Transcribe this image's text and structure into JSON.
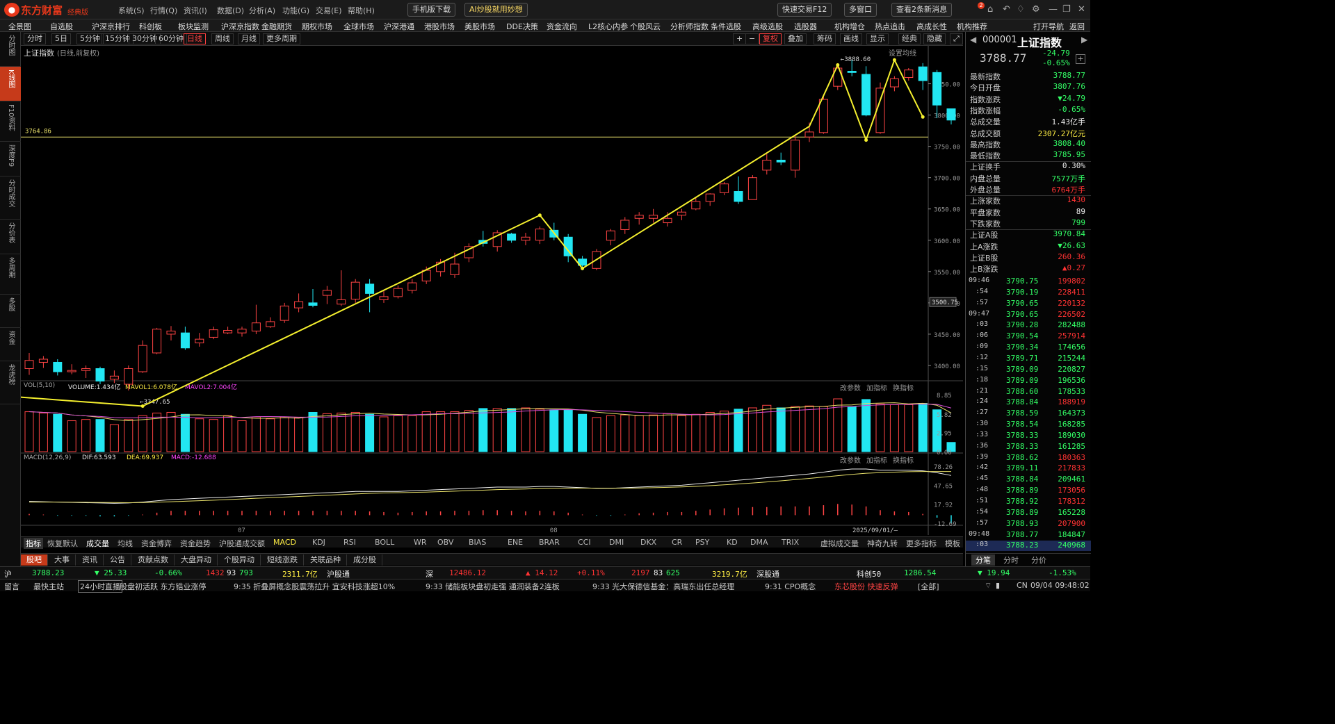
{
  "app": {
    "brand": "东方财富",
    "brand_sub": "经典版",
    "menus": [
      "系统(S)",
      "行情(Q)",
      "资讯(I)",
      "数据(D)",
      "分析(A)",
      "功能(G)",
      "交易(E)",
      "帮助(H)"
    ],
    "mobile_btn": "手机版下载",
    "ai_btn": "AI炒股就用妙想",
    "quick_trade": "快速交易F12",
    "multi_window": "多窗口",
    "message": "查看2条新消息",
    "msg_badge": "2"
  },
  "nav": [
    "全景图",
    "自选股",
    "沪深京排行",
    "科创板",
    "板块监测",
    "沪深京指数",
    "金融期货",
    "期权市场",
    "全球市场",
    "沪深港通",
    "港股市场",
    "美股市场",
    "DDE决策",
    "资金流向",
    "L2核心内参",
    "个股风云",
    "分析师指数",
    "条件选股",
    "高级选股",
    "选股器",
    "机构增仓",
    "热点追击",
    "高成长性",
    "机构推荐",
    "打开导航",
    "返回"
  ],
  "sidebar": [
    "分时图",
    "K线图",
    "F10资料",
    "深度F9",
    "分时成交",
    "分价表",
    "多周期",
    "多股",
    "资金",
    "龙虎榜"
  ],
  "periods": [
    "分时",
    "5日",
    "5分钟",
    "15分钟",
    "30分钟",
    "60分钟",
    "日线",
    "周线",
    "月线",
    "更多周期"
  ],
  "period_selected": "日线",
  "chart_tools": [
    "复权",
    "叠加",
    "筹码",
    "画线",
    "显示",
    "经典",
    "隐藏"
  ],
  "chart_header": {
    "index_name": "上证指数",
    "desc": "(日线,前复权)",
    "set_ma": "设置均线"
  },
  "chart_data": {
    "type": "candlestick",
    "title": "上证指数",
    "ylim": [
      3380,
      3895
    ],
    "y_ticks": [
      3400.0,
      3450.0,
      3500.0,
      3550.0,
      3600.0,
      3650.0,
      3700.0,
      3750.0,
      3800.0,
      3850.0
    ],
    "hline_value": 3764.86,
    "current_price_label": "3500.75",
    "high_label": "3888.60",
    "low_label": "3347.65",
    "x_labels": [
      {
        "i": 15,
        "text": "07"
      },
      {
        "i": 37,
        "text": "08"
      }
    ],
    "date_label": "2025/09/01/—",
    "candles": [
      {
        "o": 3395,
        "c": 3408,
        "h": 3420,
        "l": 3385,
        "v": 6.2
      },
      {
        "o": 3405,
        "c": 3410,
        "h": 3415,
        "l": 3396,
        "v": 6.0
      },
      {
        "o": 3405,
        "c": 3390,
        "h": 3410,
        "l": 3384,
        "v": 5.8
      },
      {
        "o": 3390,
        "c": 3392,
        "h": 3402,
        "l": 3386,
        "v": 4.8
      },
      {
        "o": 3392,
        "c": 3395,
        "h": 3400,
        "l": 3380,
        "v": 5.0
      },
      {
        "o": 3395,
        "c": 3375,
        "h": 3398,
        "l": 3370,
        "v": 5.0
      },
      {
        "o": 3378,
        "c": 3383,
        "h": 3392,
        "l": 3372,
        "v": 4.2
      },
      {
        "o": 3370,
        "c": 3395,
        "h": 3400,
        "l": 3360,
        "v": 5.0
      },
      {
        "o": 3390,
        "c": 3432,
        "h": 3440,
        "l": 3388,
        "v": 5.6
      },
      {
        "o": 3420,
        "c": 3458,
        "h": 3460,
        "l": 3418,
        "v": 6.0
      },
      {
        "o": 3450,
        "c": 3455,
        "h": 3463,
        "l": 3440,
        "v": 6.1
      },
      {
        "o": 3452,
        "c": 3428,
        "h": 3462,
        "l": 3425,
        "v": 5.8
      },
      {
        "o": 3436,
        "c": 3442,
        "h": 3452,
        "l": 3430,
        "v": 5.1
      },
      {
        "o": 3445,
        "c": 3457,
        "h": 3462,
        "l": 3442,
        "v": 5.0
      },
      {
        "o": 3452,
        "c": 3456,
        "h": 3462,
        "l": 3450,
        "v": 5.6
      },
      {
        "o": 3452,
        "c": 3458,
        "h": 3462,
        "l": 3446,
        "v": 4.8
      },
      {
        "o": 3455,
        "c": 3468,
        "h": 3497,
        "l": 3450,
        "v": 5.4
      },
      {
        "o": 3462,
        "c": 3470,
        "h": 3477,
        "l": 3460,
        "v": 5.1
      },
      {
        "o": 3472,
        "c": 3495,
        "h": 3500,
        "l": 3468,
        "v": 5.4
      },
      {
        "o": 3492,
        "c": 3502,
        "h": 3515,
        "l": 3485,
        "v": 5.3
      },
      {
        "o": 3500,
        "c": 3496,
        "h": 3522,
        "l": 3493,
        "v": 6.1
      },
      {
        "o": 3512,
        "c": 3520,
        "h": 3527,
        "l": 3498,
        "v": 5.9
      },
      {
        "o": 3498,
        "c": 3505,
        "h": 3552,
        "l": 3495,
        "v": 6.0
      },
      {
        "o": 3506,
        "c": 3533,
        "h": 3538,
        "l": 3500,
        "v": 6.1
      },
      {
        "o": 3530,
        "c": 3515,
        "h": 3538,
        "l": 3485,
        "v": 5.8
      },
      {
        "o": 3505,
        "c": 3510,
        "h": 3520,
        "l": 3500,
        "v": 5.4
      },
      {
        "o": 3510,
        "c": 3523,
        "h": 3528,
        "l": 3507,
        "v": 5.6
      },
      {
        "o": 3520,
        "c": 3532,
        "h": 3538,
        "l": 3515,
        "v": 5.6
      },
      {
        "o": 3535,
        "c": 3552,
        "h": 3558,
        "l": 3530,
        "v": 6.2
      },
      {
        "o": 3550,
        "c": 3565,
        "h": 3570,
        "l": 3542,
        "v": 6.2
      },
      {
        "o": 3545,
        "c": 3562,
        "h": 3580,
        "l": 3540,
        "v": 6.2
      },
      {
        "o": 3572,
        "c": 3590,
        "h": 3595,
        "l": 3565,
        "v": 6.4
      },
      {
        "o": 3600,
        "c": 3595,
        "h": 3615,
        "l": 3590,
        "v": 6.7
      },
      {
        "o": 3590,
        "c": 3612,
        "h": 3616,
        "l": 3582,
        "v": 6.7
      },
      {
        "o": 3610,
        "c": 3600,
        "h": 3612,
        "l": 3596,
        "v": 6.7
      },
      {
        "o": 3600,
        "c": 3605,
        "h": 3612,
        "l": 3592,
        "v": 6.8
      },
      {
        "o": 3600,
        "c": 3618,
        "h": 3622,
        "l": 3594,
        "v": 6.6
      },
      {
        "o": 3616,
        "c": 3605,
        "h": 3628,
        "l": 3600,
        "v": 6.5
      },
      {
        "o": 3605,
        "c": 3575,
        "h": 3610,
        "l": 3565,
        "v": 6.5
      },
      {
        "o": 3570,
        "c": 3560,
        "h": 3575,
        "l": 3552,
        "v": 5.8
      },
      {
        "o": 3555,
        "c": 3582,
        "h": 3586,
        "l": 3552,
        "v": 5.3
      },
      {
        "o": 3600,
        "c": 3615,
        "h": 3618,
        "l": 3592,
        "v": 5.6
      },
      {
        "o": 3617,
        "c": 3632,
        "h": 3637,
        "l": 3610,
        "v": 5.7
      },
      {
        "o": 3635,
        "c": 3640,
        "h": 3645,
        "l": 3625,
        "v": 5.6
      },
      {
        "o": 3635,
        "c": 3640,
        "h": 3650,
        "l": 3628,
        "v": 5.7
      },
      {
        "o": 3628,
        "c": 3635,
        "h": 3645,
        "l": 3622,
        "v": 5.9
      },
      {
        "o": 3640,
        "c": 3645,
        "h": 3650,
        "l": 3632,
        "v": 5.6
      },
      {
        "o": 3650,
        "c": 3662,
        "h": 3668,
        "l": 3648,
        "v": 5.8
      },
      {
        "o": 3662,
        "c": 3674,
        "h": 3675,
        "l": 3655,
        "v": 6.1
      },
      {
        "o": 3676,
        "c": 3690,
        "h": 3693,
        "l": 3672,
        "v": 6.3
      },
      {
        "o": 3678,
        "c": 3662,
        "h": 3702,
        "l": 3658,
        "v": 6.6
      },
      {
        "o": 3665,
        "c": 3700,
        "h": 3704,
        "l": 3665,
        "v": 6.8
      },
      {
        "o": 3712,
        "c": 3728,
        "h": 3738,
        "l": 3705,
        "v": 7.2
      },
      {
        "o": 3728,
        "c": 3725,
        "h": 3740,
        "l": 3720,
        "v": 6.8
      },
      {
        "o": 3712,
        "c": 3760,
        "h": 3768,
        "l": 3700,
        "v": 7.0
      },
      {
        "o": 3765,
        "c": 3773,
        "h": 3788,
        "l": 3757,
        "v": 7.1
      },
      {
        "o": 3772,
        "c": 3825,
        "h": 3830,
        "l": 3770,
        "v": 7.0
      },
      {
        "o": 3846,
        "c": 3875,
        "h": 3882,
        "l": 3840,
        "v": 8.2
      },
      {
        "o": 3870,
        "c": 3868,
        "h": 3888,
        "l": 3862,
        "v": 7.0
      },
      {
        "o": 3865,
        "c": 3800,
        "h": 3878,
        "l": 3798,
        "v": 8.1
      },
      {
        "o": 3772,
        "c": 3843,
        "h": 3852,
        "l": 3770,
        "v": 7.4
      },
      {
        "o": 3845,
        "c": 3858,
        "h": 3862,
        "l": 3838,
        "v": 7.3
      },
      {
        "o": 3860,
        "c": 3872,
        "h": 3875,
        "l": 3855,
        "v": 7.3
      },
      {
        "o": 3877,
        "c": 3855,
        "h": 3883,
        "l": 3840,
        "v": 7.5
      },
      {
        "o": 3868,
        "c": 3816,
        "h": 3872,
        "l": 3795,
        "v": 6.5
      },
      {
        "o": 3810,
        "c": 3792,
        "h": 3810,
        "l": 3785,
        "v": 1.43
      }
    ],
    "vol_ylim": [
      0,
      8.85
    ],
    "vol_ticks": [
      "8.85",
      "5.82",
      "2.95",
      "0.00"
    ],
    "macd_ticks": [
      "78.26",
      "47.65",
      "17.92",
      "-12.69"
    ],
    "macd_ylim": [
      -14,
      84
    ],
    "dif": [
      22,
      21.5,
      21,
      20.5,
      20,
      19.5,
      19,
      19.5,
      21,
      23,
      25,
      26,
      27,
      28,
      29,
      30,
      31,
      32,
      33,
      34,
      35,
      36,
      37,
      38,
      38,
      38,
      38,
      39,
      40,
      41,
      42,
      43,
      44,
      45,
      45,
      45,
      46,
      46,
      45,
      44,
      43,
      43,
      44,
      45,
      46,
      47,
      48,
      50,
      52,
      54,
      56,
      58,
      60,
      62,
      64,
      66,
      69,
      72,
      74,
      74,
      72,
      72,
      72,
      71,
      68,
      63.6
    ],
    "dea": [
      21,
      21,
      21,
      20.8,
      20.6,
      20.4,
      20.2,
      20,
      20.3,
      20.8,
      21.5,
      22.3,
      23.1,
      24,
      25,
      26,
      27,
      28,
      29,
      30,
      31,
      32,
      33,
      34,
      35,
      35.5,
      36,
      36.5,
      37,
      37.8,
      38.5,
      39.3,
      40,
      41,
      41.5,
      42,
      42.5,
      43,
      43.2,
      43.3,
      43.2,
      43.1,
      43.2,
      43.5,
      44,
      44.6,
      45.3,
      46.2,
      47.3,
      48.6,
      50,
      51.6,
      53.3,
      55.1,
      57,
      58.9,
      61,
      63.2,
      65.4,
      67.1,
      68.1,
      69,
      69.6,
      70,
      69.9,
      69.9
    ],
    "macd_hist": [
      2,
      1,
      -1,
      -1,
      -1,
      -2,
      -2,
      -1,
      1,
      4,
      7,
      7,
      7,
      7,
      7,
      7,
      7,
      7,
      7,
      7,
      7,
      7,
      7,
      7,
      6,
      5,
      4,
      5,
      6,
      6,
      7,
      7,
      8,
      8,
      7,
      6,
      7,
      6,
      4,
      1,
      -1,
      -1,
      1,
      3,
      4,
      5,
      5,
      7,
      9,
      11,
      12,
      13,
      13,
      14,
      14,
      14,
      16,
      18,
      17,
      14,
      8,
      6,
      5,
      2,
      -4,
      -12.7
    ]
  },
  "vol_header": {
    "label": "VOL(5,10)",
    "volume": "VOLUME:1.434亿",
    "mavol1": "MAVOL1:6.078亿",
    "mavol2": "MAVOL2:7.004亿"
  },
  "macd_header": {
    "label": "MACD(12,26,9)",
    "dif": "DIF:63.593",
    "dea": "DEA:69.937",
    "macd": "MACD:-12.688"
  },
  "panel_tools": [
    "改参数",
    "加指标",
    "换指标"
  ],
  "indicator_tabs": [
    "指标",
    "恢复默认",
    "成交量",
    "均线",
    "资金博弈",
    "资金趋势",
    "沪股通成交额",
    "MACD",
    "KDJ",
    "RSI",
    "BOLL",
    "WR",
    "OBV",
    "BIAS",
    "ENE",
    "BRAR",
    "CCI",
    "DMI",
    "DKX",
    "CR",
    "PSY",
    "KD",
    "DMA",
    "TRIX",
    "虚拟成交量",
    "神奇九转",
    "更多指标",
    "模板"
  ],
  "news_tabs": [
    "股吧",
    "大事",
    "资讯",
    "公告",
    "贡献点数",
    "大盘异动",
    "个股异动",
    "短线涨跌",
    "关联品种",
    "成分股"
  ],
  "right": {
    "code": "000001",
    "name": "上证指数",
    "price": "3788.77",
    "change": "-24.79",
    "pct": "-0.65%",
    "stats": [
      {
        "label": "最新指数",
        "value": "3788.77",
        "cls": "green"
      },
      {
        "label": "今日开盘",
        "value": "3807.76",
        "cls": "green"
      },
      {
        "label": "指数涨跌",
        "value": "▼24.79",
        "cls": "green"
      },
      {
        "label": "指数涨幅",
        "value": "-0.65%",
        "cls": "green"
      },
      {
        "label": "总成交量",
        "value": "1.43亿手",
        "cls": "white"
      },
      {
        "label": "总成交额",
        "value": "2307.27亿元",
        "cls": "yellow"
      },
      {
        "label": "最高指数",
        "value": "3808.40",
        "cls": "green"
      },
      {
        "label": "最低指数",
        "value": "3785.95",
        "cls": "green"
      },
      {
        "label": "上证换手",
        "value": "0.30%",
        "cls": "white"
      },
      {
        "label": "内盘总量",
        "value": "7577万手",
        "cls": "green"
      },
      {
        "label": "外盘总量",
        "value": "6764万手",
        "cls": "red"
      },
      {
        "label": "上涨家数",
        "value": "1430",
        "cls": "red"
      },
      {
        "label": "平盘家数",
        "value": "89",
        "cls": "white"
      },
      {
        "label": "下跌家数",
        "value": "799",
        "cls": "green"
      },
      {
        "label": "上证A股",
        "value": "3970.84",
        "cls": "green"
      },
      {
        "label": "上A涨跌",
        "value": "▼26.63",
        "cls": "green"
      },
      {
        "label": "上证B股",
        "value": "260.36",
        "cls": "red"
      },
      {
        "label": "上B涨跌",
        "value": "▲0.27",
        "cls": "red"
      }
    ],
    "ticks": [
      {
        "t": "09:46",
        "p": "3790.75",
        "v": "199802",
        "vc": "red"
      },
      {
        "t": ":54",
        "p": "3790.19",
        "v": "228411",
        "vc": "red"
      },
      {
        "t": ":57",
        "p": "3790.65",
        "v": "220132",
        "vc": "red"
      },
      {
        "t": "09:47",
        "p": "3790.65",
        "v": "226502",
        "vc": "red"
      },
      {
        "t": ":03",
        "p": "3790.28",
        "v": "282488",
        "vc": "green"
      },
      {
        "t": ":06",
        "p": "3790.54",
        "v": "257914",
        "vc": "red"
      },
      {
        "t": ":09",
        "p": "3790.34",
        "v": "174656",
        "vc": "green"
      },
      {
        "t": ":12",
        "p": "3789.71",
        "v": "215244",
        "vc": "green"
      },
      {
        "t": ":15",
        "p": "3789.09",
        "v": "220827",
        "vc": "green"
      },
      {
        "t": ":18",
        "p": "3789.09",
        "v": "196536",
        "vc": "green"
      },
      {
        "t": ":21",
        "p": "3788.60",
        "v": "178533",
        "vc": "green"
      },
      {
        "t": ":24",
        "p": "3788.84",
        "v": "188919",
        "vc": "red"
      },
      {
        "t": ":27",
        "p": "3788.59",
        "v": "164373",
        "vc": "green"
      },
      {
        "t": ":30",
        "p": "3788.54",
        "v": "168285",
        "vc": "green"
      },
      {
        "t": ":33",
        "p": "3788.33",
        "v": "189030",
        "vc": "green"
      },
      {
        "t": ":36",
        "p": "3788.33",
        "v": "161285",
        "vc": "green"
      },
      {
        "t": ":39",
        "p": "3788.62",
        "v": "180363",
        "vc": "red"
      },
      {
        "t": ":42",
        "p": "3789.11",
        "v": "217833",
        "vc": "red"
      },
      {
        "t": ":45",
        "p": "3788.84",
        "v": "209461",
        "vc": "green"
      },
      {
        "t": ":48",
        "p": "3788.89",
        "v": "173056",
        "vc": "red"
      },
      {
        "t": ":51",
        "p": "3788.92",
        "v": "178312",
        "vc": "red"
      },
      {
        "t": ":54",
        "p": "3788.89",
        "v": "165228",
        "vc": "green"
      },
      {
        "t": ":57",
        "p": "3788.93",
        "v": "207900",
        "vc": "red"
      },
      {
        "t": "09:48",
        "p": "3788.77",
        "v": "184847",
        "vc": "green"
      },
      {
        "t": ":03",
        "p": "3788.23",
        "v": "240968",
        "vc": "green"
      }
    ],
    "bottom_tabs": [
      "分笔",
      "分时",
      "分价"
    ]
  },
  "status": {
    "sh_label": "沪",
    "sh_price": "3788.23",
    "sh_change": "▼ 25.33",
    "sh_pct": "-0.66%",
    "sh_up": "1432",
    "sh_flat": "93",
    "sh_down": "793",
    "sh_amount": "2311.7亿",
    "hgt": "沪股通",
    "sz_label": "深",
    "sz_price": "12486.12",
    "sz_change": "▲ 14.12",
    "sz_pct": "+0.11%",
    "sz_up": "2197",
    "sz_flat": "83",
    "sz_down": "625",
    "sz_amount": "3219.7亿",
    "sgt": "深股通",
    "kc_label": "科创50",
    "kc_price": "1286.54",
    "kc_change": "▼ 19.94",
    "kc_pct": "-1.53%"
  },
  "ticker": {
    "left1": "留言",
    "left2": "最快主站",
    "live": "24小时直播",
    "items": [
      "股盘初活跃  东方锆业涨停",
      "9:35  折叠屏概念股震荡拉升  宜安科技涨超10%",
      "9:33  储能板块盘初走强  通润装备2连板",
      "9:33  光大保德信基金：高瑞东出任总经理",
      "9:31  CPO概念"
    ],
    "alert": "东芯股份  快速反弹",
    "all": "[全部]",
    "cn": "CN",
    "datetime": "09/04  09:48:02"
  }
}
